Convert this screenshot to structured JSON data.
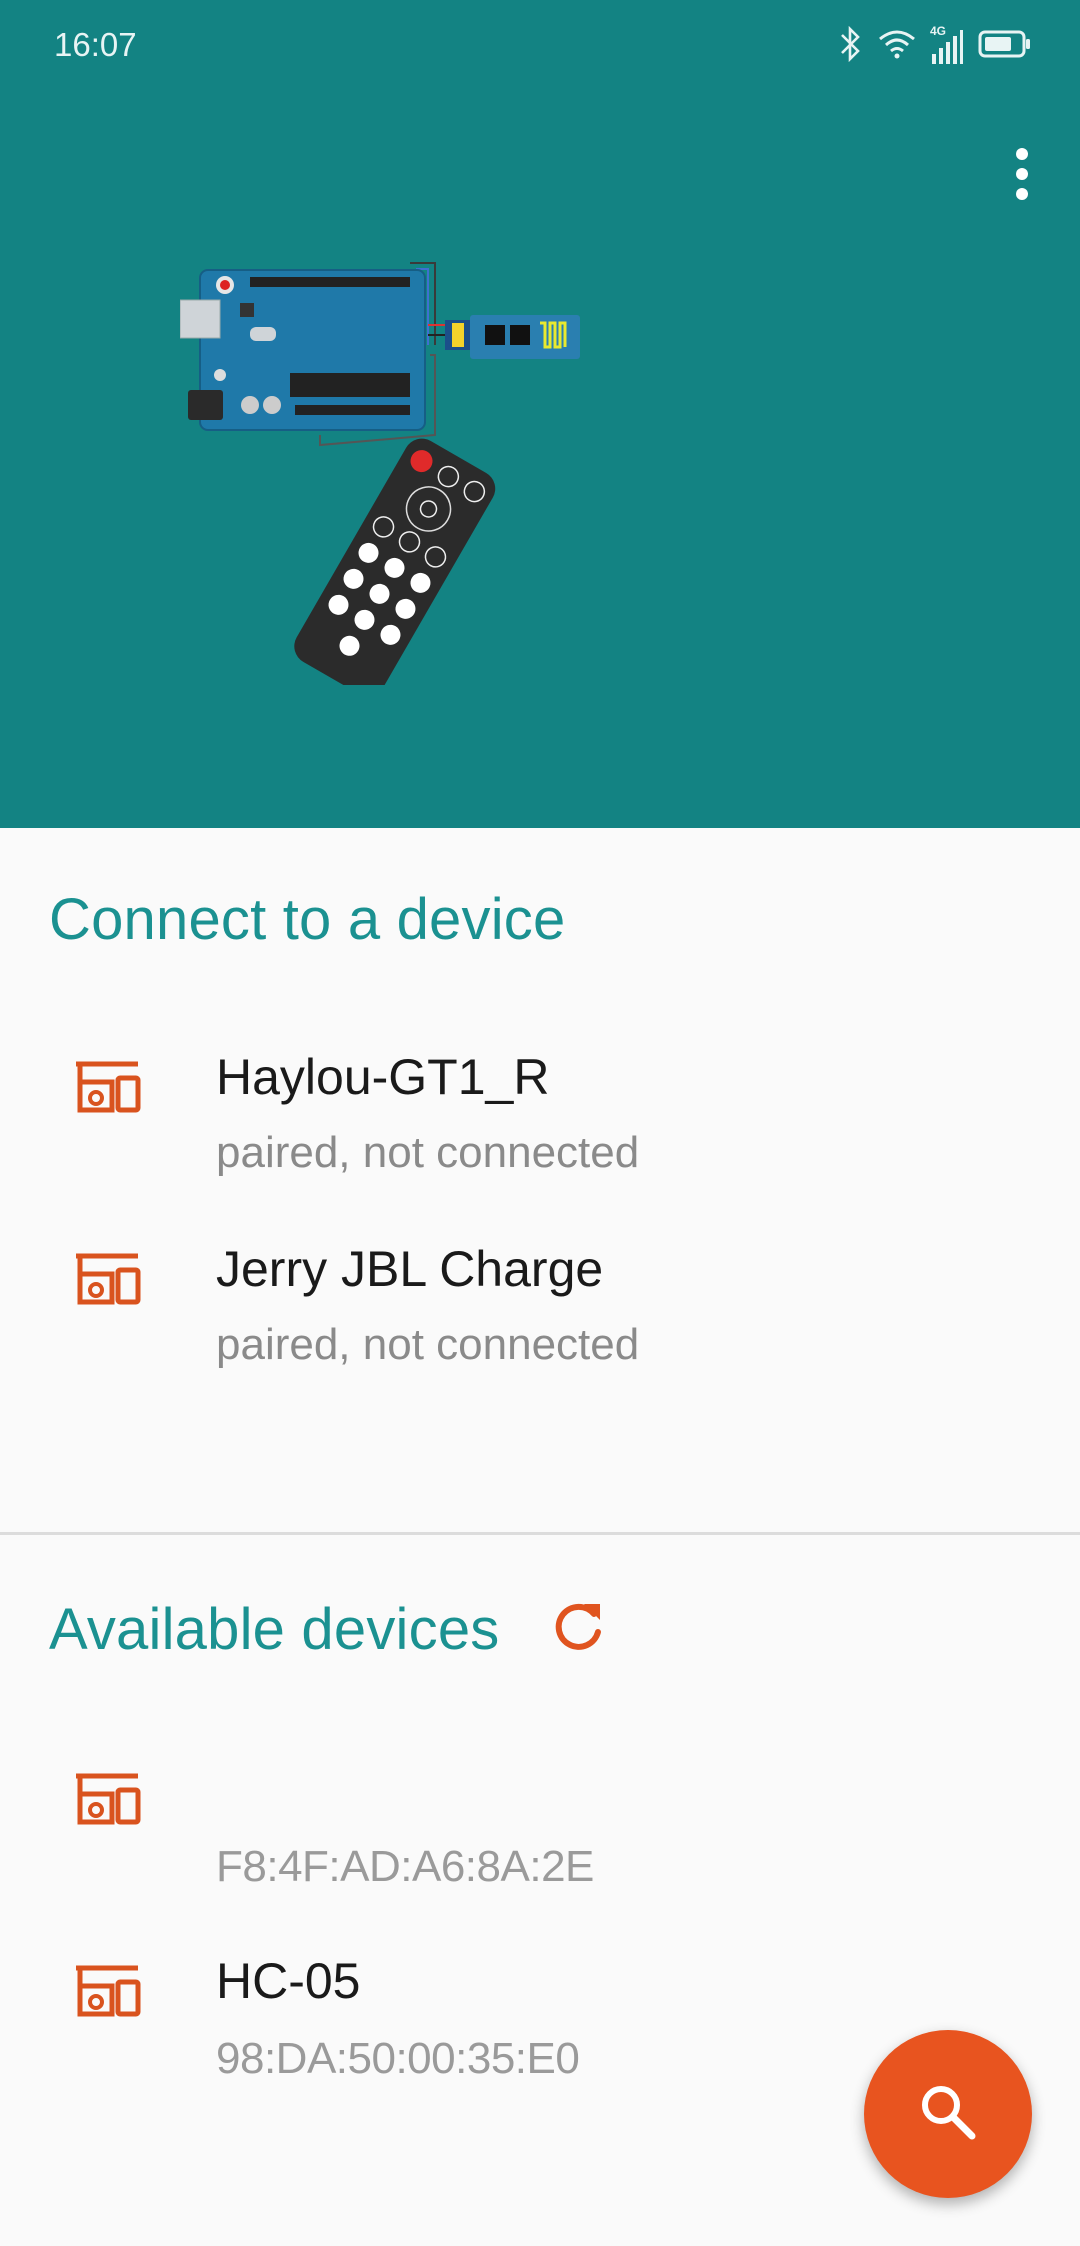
{
  "status_bar": {
    "time": "16:07",
    "network_label": "4G",
    "icons": [
      "bluetooth-icon",
      "wifi-icon",
      "cellular-signal-icon",
      "battery-icon"
    ]
  },
  "header": {
    "background_color": "#138383",
    "menu_icon": "more-vert-icon",
    "illustration": "arduino-bluetooth-remote-illustration"
  },
  "paired_section": {
    "title": "Connect to a device",
    "devices": [
      {
        "name": "Haylou-GT1_R",
        "status": "paired, not connected"
      },
      {
        "name": "Jerry JBL Charge",
        "status": "paired, not connected"
      }
    ]
  },
  "available_section": {
    "title": "Available devices",
    "refresh_icon": "refresh-icon",
    "devices": [
      {
        "name": "",
        "address": "F8:4F:AD:A6:8A:2E"
      },
      {
        "name": "HC-05",
        "address": "98:DA:50:00:35:E0"
      }
    ]
  },
  "fab": {
    "icon": "search-icon",
    "color": "#e8541f"
  },
  "colors": {
    "accent": "#1b9191",
    "device_icon": "#d9531e"
  }
}
